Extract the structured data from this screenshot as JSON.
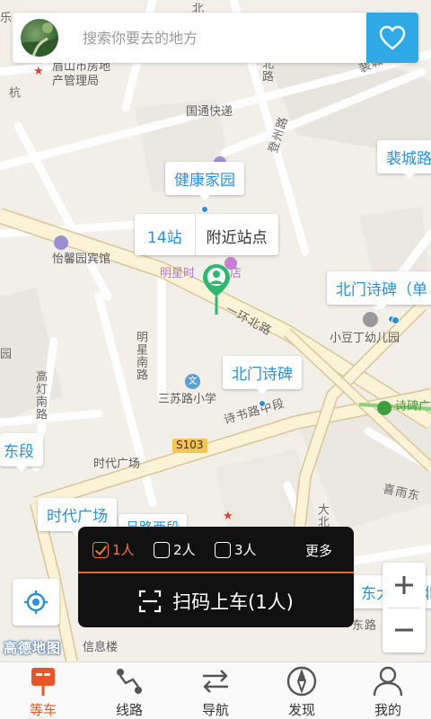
{
  "search": {
    "placeholder": "搜索你要去的地方"
  },
  "map": {
    "labels": {
      "housing_bureau_1": "眉山市房地",
      "housing_bureau_2": "产管理局",
      "guotong": "国通快递",
      "dengzhou_rd": "登州路",
      "beicheng": "裴城路",
      "yixin_hotel": "怡馨园宾馆",
      "mingxing_hotel": "明星时",
      "mingxing_hotel_tail": "店",
      "yihuan_bei_rd": "一环北路",
      "xiaodoudin": "小豆丁幼儿园",
      "mingxing_nan_rd": "明星南路",
      "gaodeng_nan_rd": "高灯南路",
      "sansu_school": "三苏路小学",
      "shishu_zhong": "诗书路中段",
      "s103": "S103",
      "shidai_plaza": "时代广场",
      "xiyu_east": "喜雨东",
      "dong_duan": "东段",
      "bei_road_top": "北",
      "bei_lu_diag": "北路",
      "beicheng_rd": "裴城路",
      "yuan": "园",
      "xiyu_lu_partial": "吕路西段",
      "dabei": "大北",
      "xin_yi": "信息楼",
      "dong_da": "东大",
      "dong_lu": "东路",
      "shibei": "诗碑广",
      "yi": "一",
      "le": "乐",
      "hang": "杭"
    },
    "callouts": {
      "jiankang": "健康家园",
      "station_count": "14站",
      "nearby": "附近站点",
      "beimen_1": "北门诗碑（单",
      "beimen_2": "北门诗碑",
      "shidai": "时代广场",
      "dongda_bei": "东大市场北"
    },
    "logo": "高德地图"
  },
  "scan_panel": {
    "options": [
      {
        "label": "1人",
        "selected": true
      },
      {
        "label": "2人",
        "selected": false
      },
      {
        "label": "3人",
        "selected": false
      }
    ],
    "more": "更多",
    "scan_button": "扫码上车(1人)"
  },
  "nav": {
    "items": [
      {
        "label": "等车",
        "icon": "bus-stop-icon",
        "active": true
      },
      {
        "label": "线路",
        "icon": "route-icon",
        "active": false
      },
      {
        "label": "导航",
        "icon": "navigation-arrows-icon",
        "active": false
      },
      {
        "label": "发现",
        "icon": "compass-icon",
        "active": false
      },
      {
        "label": "我的",
        "icon": "user-icon",
        "active": false
      }
    ]
  },
  "colors": {
    "accent_blue": "#2faae7",
    "accent_orange": "#e8552a",
    "panel_bg": "#111111"
  }
}
